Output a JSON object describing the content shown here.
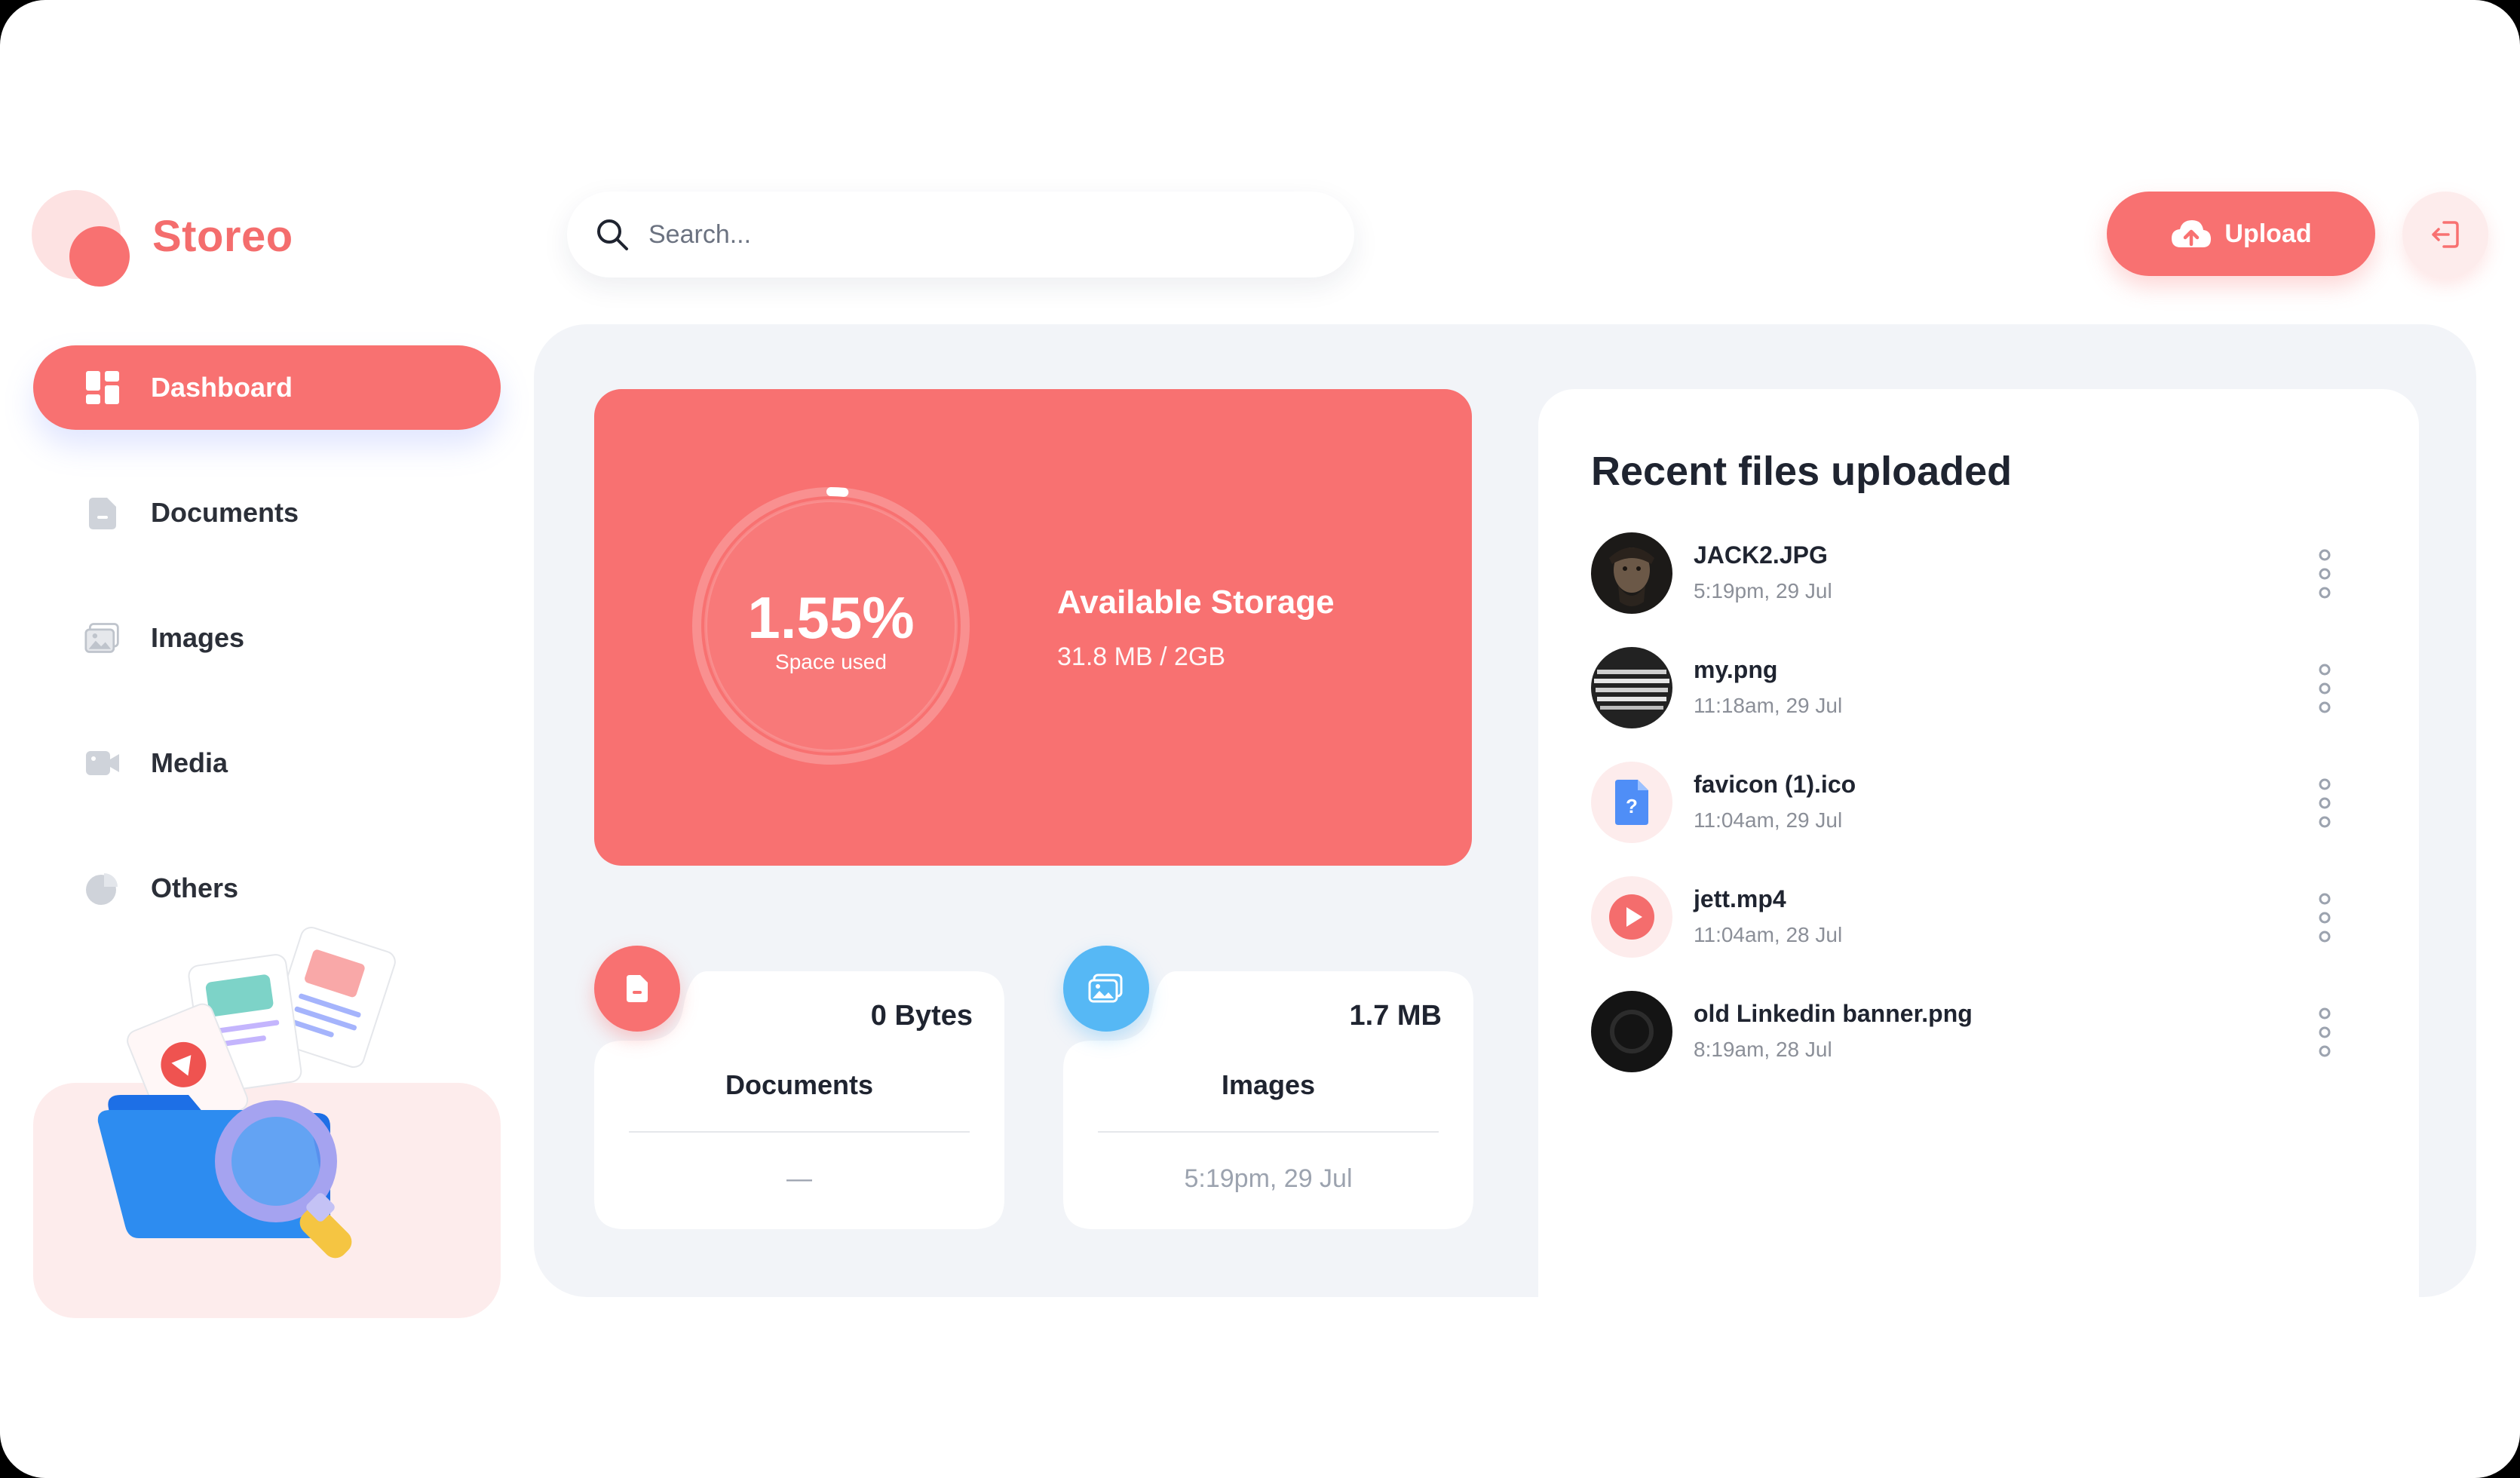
{
  "app": {
    "name": "Storeo"
  },
  "colors": {
    "accent": "#f87171",
    "accent_soft": "#fdecec",
    "image_blue": "#56b8f5",
    "panel_bg": "#f2f4f8"
  },
  "sidebar": {
    "items": [
      {
        "label": "Dashboard",
        "icon": "dashboard-icon",
        "active": true
      },
      {
        "label": "Documents",
        "icon": "document-icon",
        "active": false
      },
      {
        "label": "Images",
        "icon": "images-icon",
        "active": false
      },
      {
        "label": "Media",
        "icon": "video-icon",
        "active": false
      },
      {
        "label": "Others",
        "icon": "pie-chart-icon",
        "active": false
      }
    ]
  },
  "header": {
    "search_placeholder": "Search...",
    "upload_label": "Upload",
    "upload_icon": "cloud-upload-icon",
    "logout_icon": "logout-icon"
  },
  "storage": {
    "percent_label": "1.55%",
    "percent_value": 1.55,
    "ring_caption": "Space used",
    "title": "Available Storage",
    "usage": "31.8 MB / 2GB"
  },
  "stats": [
    {
      "size": "0 Bytes",
      "name": "Documents",
      "footer": "—",
      "icon": "document-icon"
    },
    {
      "size": "1.7 MB",
      "name": "Images",
      "footer": "5:19pm, 29 Jul",
      "icon": "images-icon"
    }
  ],
  "recent": {
    "title": "Recent files uploaded",
    "files": [
      {
        "name": "JACK2.JPG",
        "time": "5:19pm, 29 Jul",
        "thumb": "portrait-photo-thumbnail"
      },
      {
        "name": "my.png",
        "time": "11:18am, 29 Jul",
        "thumb": "text-image-thumbnail"
      },
      {
        "name": "favicon (1).ico",
        "time": "11:04am, 29 Jul",
        "thumb": "unknown-file-icon"
      },
      {
        "name": "jett.mp4",
        "time": "11:04am, 28 Jul",
        "thumb": "play-icon"
      },
      {
        "name": "old Linkedin banner.png",
        "time": "8:19am, 28 Jul",
        "thumb": "dark-image-thumbnail"
      }
    ]
  }
}
